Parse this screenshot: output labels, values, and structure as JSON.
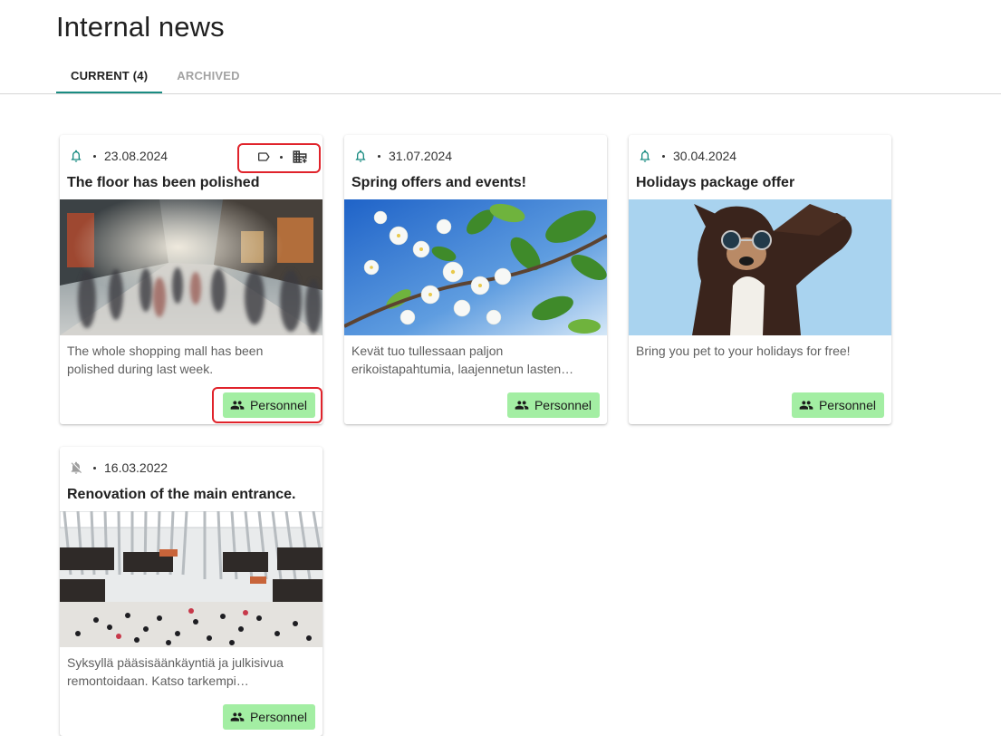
{
  "page": {
    "title": "Internal news"
  },
  "tabs": [
    {
      "label": "CURRENT (4)",
      "active": true
    },
    {
      "label": "ARCHIVED",
      "active": false
    }
  ],
  "colors": {
    "accent": "#1a8c82",
    "badge": "#a3eea3",
    "highlight": "#e0232b"
  },
  "cards": [
    {
      "status_icon": "bell-icon",
      "date": "23.08.2024",
      "title": "The floor has been polished",
      "image": "blurred shopping mall crowd",
      "description": "The whole shopping mall has been polished during last week.",
      "badge": "Personnel",
      "badge_icon": "group-icon",
      "actions": [
        "label-tag-icon",
        "building-add-icon"
      ]
    },
    {
      "status_icon": "bell-icon",
      "date": "31.07.2024",
      "title": "Spring offers and events!",
      "image": "white spring blossoms against blue sky",
      "description": "Kevät tuo tullessaan paljon erikoistapahtumia, laajennetun lasten…",
      "badge": "Personnel",
      "badge_icon": "group-icon"
    },
    {
      "status_icon": "bell-icon",
      "date": "30.04.2024",
      "title": "Holidays package offer",
      "image": "dog wearing sunglasses",
      "description": "Bring you pet to your holidays for free!",
      "badge": "Personnel",
      "badge_icon": "group-icon"
    },
    {
      "status_icon": "bell-off-icon",
      "date": "16.03.2022",
      "title": "Renovation of the main entrance.",
      "image": "white ribbed mall atrium with crowd",
      "description": "Syksyllä pääsisäänkäyntiä ja julkisivua remontoidaan. Katso tarkempi…",
      "badge": "Personnel",
      "badge_icon": "group-icon"
    }
  ]
}
